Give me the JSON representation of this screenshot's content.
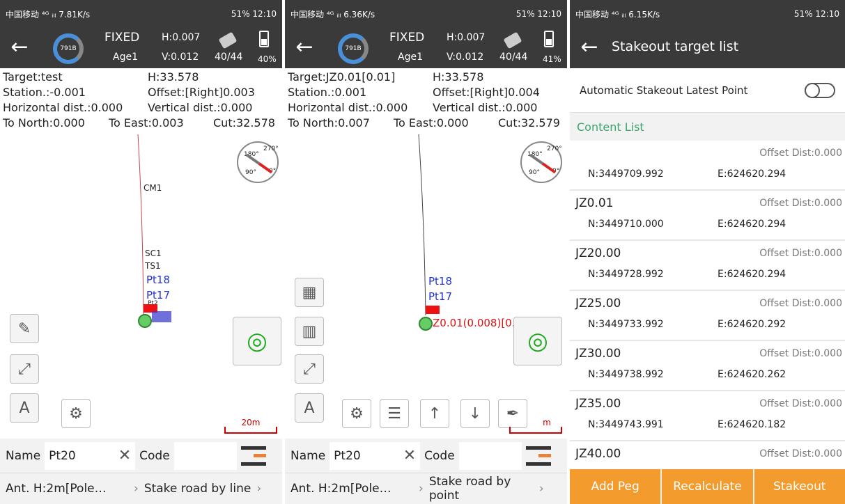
{
  "screens": [
    {
      "status": {
        "left": "中国移动 ⁴ᴳ ᵢₗₗ 7.81K/s",
        "right": "51% 12:10"
      },
      "header": {
        "ring": "791B",
        "fix": "FIXED",
        "h": "H:0.007",
        "age": "Age1",
        "v": "V:0.012",
        "sats": "40/44",
        "battery": "40%"
      },
      "info": {
        "target": "Target:test",
        "h": "H:33.578",
        "station": "Station.:-0.001",
        "offset": "Offset:[Right]0.003",
        "hdist": "Horizontal dist.:0.000",
        "vdist": "Vertical dist.:0.000",
        "north": "To North:0.000",
        "east": "To East:0.003",
        "cut": "Cut:32.578"
      },
      "map": {
        "labels": [
          "CM1",
          "SC1",
          "TS1",
          "Pt18",
          "Pt17",
          "Pt2"
        ],
        "scale": "20m"
      },
      "name_label": "Name",
      "name_value": "Pt20",
      "code_label": "Code",
      "ant": "Ant. H:2m[Pole…",
      "mode": "Stake road by line"
    },
    {
      "status": {
        "left": "中国移动 ⁴ᴳ ᵢₗₗ 6.36K/s",
        "right": "51% 12:10"
      },
      "header": {
        "ring": "791B",
        "fix": "FIXED",
        "h": "H:0.007",
        "age": "Age1",
        "v": "V:0.012",
        "sats": "40/44",
        "battery": "41%"
      },
      "info": {
        "target": "Target:JZ0.01[0.01]",
        "h": "H:33.578",
        "station": "Station.:0.001",
        "offset": "Offset:[Right]0.004",
        "hdist": "Horizontal dist.:0.000",
        "vdist": "Vertical dist.:0.000",
        "north": "To North:0.007",
        "east": "To East:0.000",
        "cut": "Cut:32.579"
      },
      "map": {
        "labels": [
          "Pt18",
          "Pt17",
          "Z0.01(0.008)[0."
        ],
        "scale": "m"
      },
      "name_label": "Name",
      "name_value": "Pt20",
      "code_label": "Code",
      "ant": "Ant. H:2m[Pole…",
      "mode": "Stake road by point"
    }
  ],
  "list_screen": {
    "status": {
      "left": "中国移动 ⁴ᴳ ᵢₗₗ 6.15K/s",
      "right": "51% 12:10"
    },
    "title": "Stakeout target list",
    "auto_label": "Automatic Stakeout Latest Point",
    "section": "Content List",
    "items": [
      {
        "name": "",
        "offset": "Offset Dist:0.000",
        "n": "N:3449709.992",
        "e": "E:624620.294"
      },
      {
        "name": "JZ0.01",
        "offset": "Offset Dist:0.000",
        "n": "N:3449710.000",
        "e": "E:624620.294"
      },
      {
        "name": "JZ20.00",
        "offset": "Offset Dist:0.000",
        "n": "N:3449728.992",
        "e": "E:624620.294"
      },
      {
        "name": "JZ25.00",
        "offset": "Offset Dist:0.000",
        "n": "N:3449733.992",
        "e": "E:624620.292"
      },
      {
        "name": "JZ30.00",
        "offset": "Offset Dist:0.000",
        "n": "N:3449738.992",
        "e": "E:624620.262"
      },
      {
        "name": "JZ35.00",
        "offset": "Offset Dist:0.000",
        "n": "N:3449743.991",
        "e": "E:624620.182"
      },
      {
        "name": "JZ40.00",
        "offset": "Offset Dist:0.000",
        "n": "",
        "e": ""
      }
    ],
    "buttons": {
      "add": "Add Peg",
      "recalc": "Recalculate",
      "stakeout": "Stakeout"
    }
  }
}
